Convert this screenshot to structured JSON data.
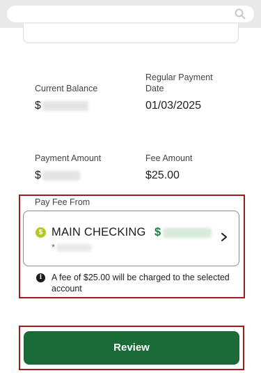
{
  "search": {
    "placeholder": ""
  },
  "details": {
    "current_balance_label": "Current Balance",
    "current_balance_prefix": "$",
    "regular_payment_date_label": "Regular Payment Date",
    "regular_payment_date_value": "01/03/2025",
    "payment_amount_label": "Payment Amount",
    "payment_amount_prefix": "$",
    "fee_amount_label": "Fee Amount",
    "fee_amount_value": "$25.00"
  },
  "pay_fee_from": {
    "label": "Pay Fee From",
    "account_name": "MAIN CHECKING",
    "account_balance_prefix": "$",
    "account_number_prefix": "*",
    "fee_note": "A fee of $25.00 will be charged to the selected account"
  },
  "actions": {
    "review_label": "Review"
  },
  "colors": {
    "primary_green": "#1a6b37",
    "highlight_red": "#9b1c1c",
    "dollar_icon": "#b5c91a",
    "balance_green": "#1e7a3e"
  },
  "icons": [
    "search-icon",
    "dollar-icon",
    "chevron-right-icon",
    "info-icon"
  ]
}
